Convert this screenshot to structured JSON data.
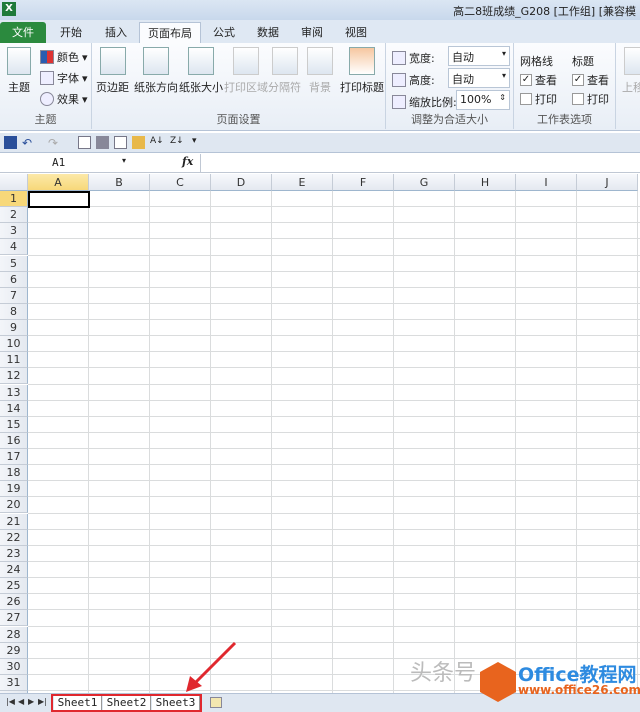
{
  "title": {
    "text": "高二8班成绩_G208  [工作组]  [兼容模"
  },
  "tabs": [
    "文件",
    "开始",
    "插入",
    "页面布局",
    "公式",
    "数据",
    "审阅",
    "视图"
  ],
  "ribbon": {
    "theme": {
      "main": "主题",
      "colors": "颜色",
      "fonts": "字体",
      "effects": "效果",
      "label": "主题"
    },
    "page_setup": {
      "items": [
        "页边距",
        "纸张方向",
        "纸张大小",
        "打印区域",
        "分隔符",
        "背景",
        "打印标题"
      ],
      "label": "页面设置"
    },
    "scale": {
      "width_label": "宽度:",
      "width_value": "自动",
      "height_label": "高度:",
      "height_value": "自动",
      "scale_label": "缩放比例:",
      "scale_value": "100%",
      "label": "调整为合适大小"
    },
    "sheet_options": {
      "gridlines": "网格线",
      "headings": "标题",
      "view": "查看",
      "print": "打印",
      "label": "工作表选项"
    },
    "arrange": {
      "first": "上移"
    }
  },
  "formula_bar": {
    "name_box": "A1",
    "fx": "fx",
    "value": ""
  },
  "columns": [
    "A",
    "B",
    "C",
    "D",
    "E",
    "F",
    "G",
    "H",
    "I",
    "J"
  ],
  "row_count": 31,
  "sheets": [
    "Sheet1",
    "Sheet2",
    "Sheet3"
  ],
  "watermark": {
    "text": "头条号",
    "brand": "Office教程网",
    "url": "www.office26.com"
  },
  "colors": {
    "accent": "#2b8a3e",
    "highlight": "#e0282e"
  }
}
